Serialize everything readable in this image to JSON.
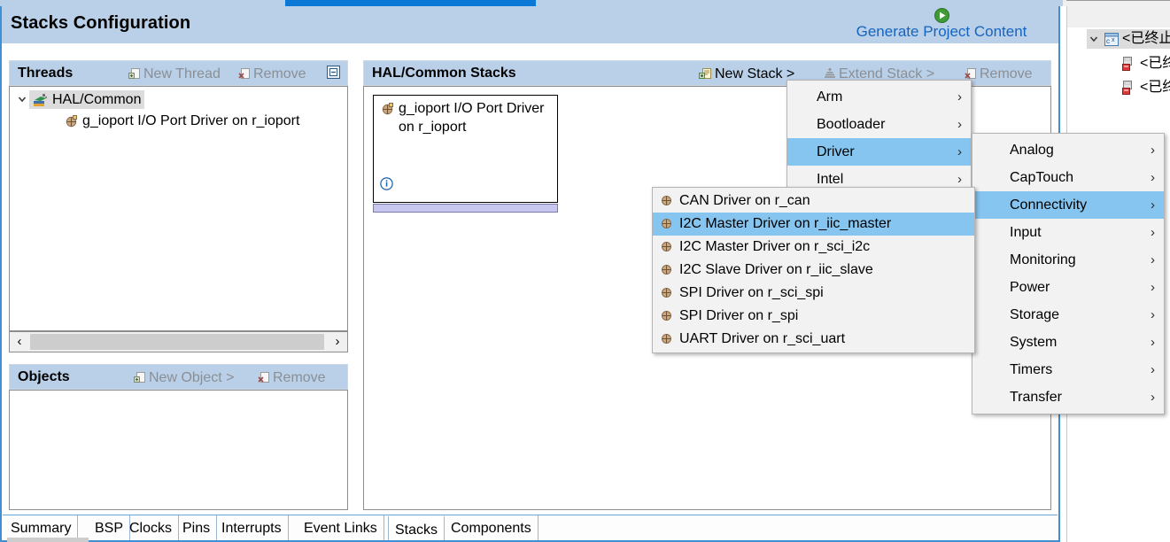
{
  "header": {
    "title": "Stacks Configuration",
    "generate_label": "Generate Project Content",
    "generate_icon": "play-circle-green-icon",
    "accent_blue": "#0a78d4",
    "band_blue": "#b9d0e8",
    "link_blue": "#1565c0"
  },
  "threads_panel": {
    "title": "Threads",
    "new_thread_label": "New Thread",
    "remove_label": "Remove",
    "collapse_all_icon": "collapse-all-icon",
    "tree": {
      "root": {
        "label": "HAL/Common",
        "icon": "hal-common-icon",
        "expanded": true,
        "selected": true
      },
      "children": [
        {
          "label": "g_ioport I/O Port Driver on r_ioport",
          "icon": "module-icon"
        }
      ]
    },
    "hscroll": {
      "left_arrow": "‹",
      "right_arrow": "›"
    }
  },
  "objects_panel": {
    "title": "Objects",
    "new_object_label": "New Object >",
    "remove_label": "Remove",
    "items": []
  },
  "stacks_panel": {
    "title": "HAL/Common Stacks",
    "new_stack_label": "New Stack >",
    "extend_stack_label": "Extend Stack >",
    "remove_label": "Remove",
    "stack_box": {
      "label": "g_ioport I/O Port Driver on r_ioport",
      "icon": "module-icon",
      "info_icon": "info-icon"
    }
  },
  "menus": {
    "new_stack": {
      "items": [
        {
          "label": "Arm",
          "submenu": true,
          "selected": false
        },
        {
          "label": "Bootloader",
          "submenu": true,
          "selected": false
        },
        {
          "label": "Driver",
          "submenu": true,
          "selected": true
        },
        {
          "label": "Intel",
          "submenu": true,
          "selected": false
        }
      ]
    },
    "driver": {
      "items": [
        {
          "label": "Analog",
          "submenu": true,
          "selected": false
        },
        {
          "label": "CapTouch",
          "submenu": true,
          "selected": false
        },
        {
          "label": "Connectivity",
          "submenu": true,
          "selected": true
        },
        {
          "label": "Input",
          "submenu": true,
          "selected": false
        },
        {
          "label": "Monitoring",
          "submenu": true,
          "selected": false
        },
        {
          "label": "Power",
          "submenu": true,
          "selected": false
        },
        {
          "label": "Storage",
          "submenu": true,
          "selected": false
        },
        {
          "label": "System",
          "submenu": true,
          "selected": false
        },
        {
          "label": "Timers",
          "submenu": true,
          "selected": false
        },
        {
          "label": "Transfer",
          "submenu": true,
          "selected": false
        }
      ]
    },
    "connectivity": {
      "items": [
        {
          "label": "CAN Driver on r_can",
          "icon": "module-icon",
          "selected": false
        },
        {
          "label": "I2C Master Driver on r_iic_master",
          "icon": "module-icon",
          "selected": true
        },
        {
          "label": "I2C Master Driver on r_sci_i2c",
          "icon": "module-icon",
          "selected": false
        },
        {
          "label": "I2C Slave Driver on r_iic_slave",
          "icon": "module-icon",
          "selected": false
        },
        {
          "label": "SPI Driver on r_sci_spi",
          "icon": "module-icon",
          "selected": false
        },
        {
          "label": "SPI Driver on r_spi",
          "icon": "module-icon",
          "selected": false
        },
        {
          "label": "UART Driver on r_sci_uart",
          "icon": "module-icon",
          "selected": false
        }
      ]
    },
    "highlight_color": "#85c5f0"
  },
  "bottom_tabs": {
    "tabs": [
      {
        "label": "Summary",
        "active": false
      },
      {
        "label": "BSP",
        "active": false
      },
      {
        "label": "Clocks",
        "active": false
      },
      {
        "label": "Pins",
        "active": false
      },
      {
        "label": "Interrupts",
        "active": false
      },
      {
        "label": "Event Links",
        "active": false
      },
      {
        "label": "Stacks",
        "active": true
      },
      {
        "label": "Components",
        "active": false
      }
    ]
  },
  "right_view": {
    "root": {
      "label": "<已终止>",
      "icon": "c-project-icon",
      "expanded": true,
      "selected": true
    },
    "children": [
      {
        "label": "<已终止",
        "icon": "thread-stack-icon"
      },
      {
        "label": "<已终止",
        "icon": "thread-stack-icon"
      }
    ]
  }
}
